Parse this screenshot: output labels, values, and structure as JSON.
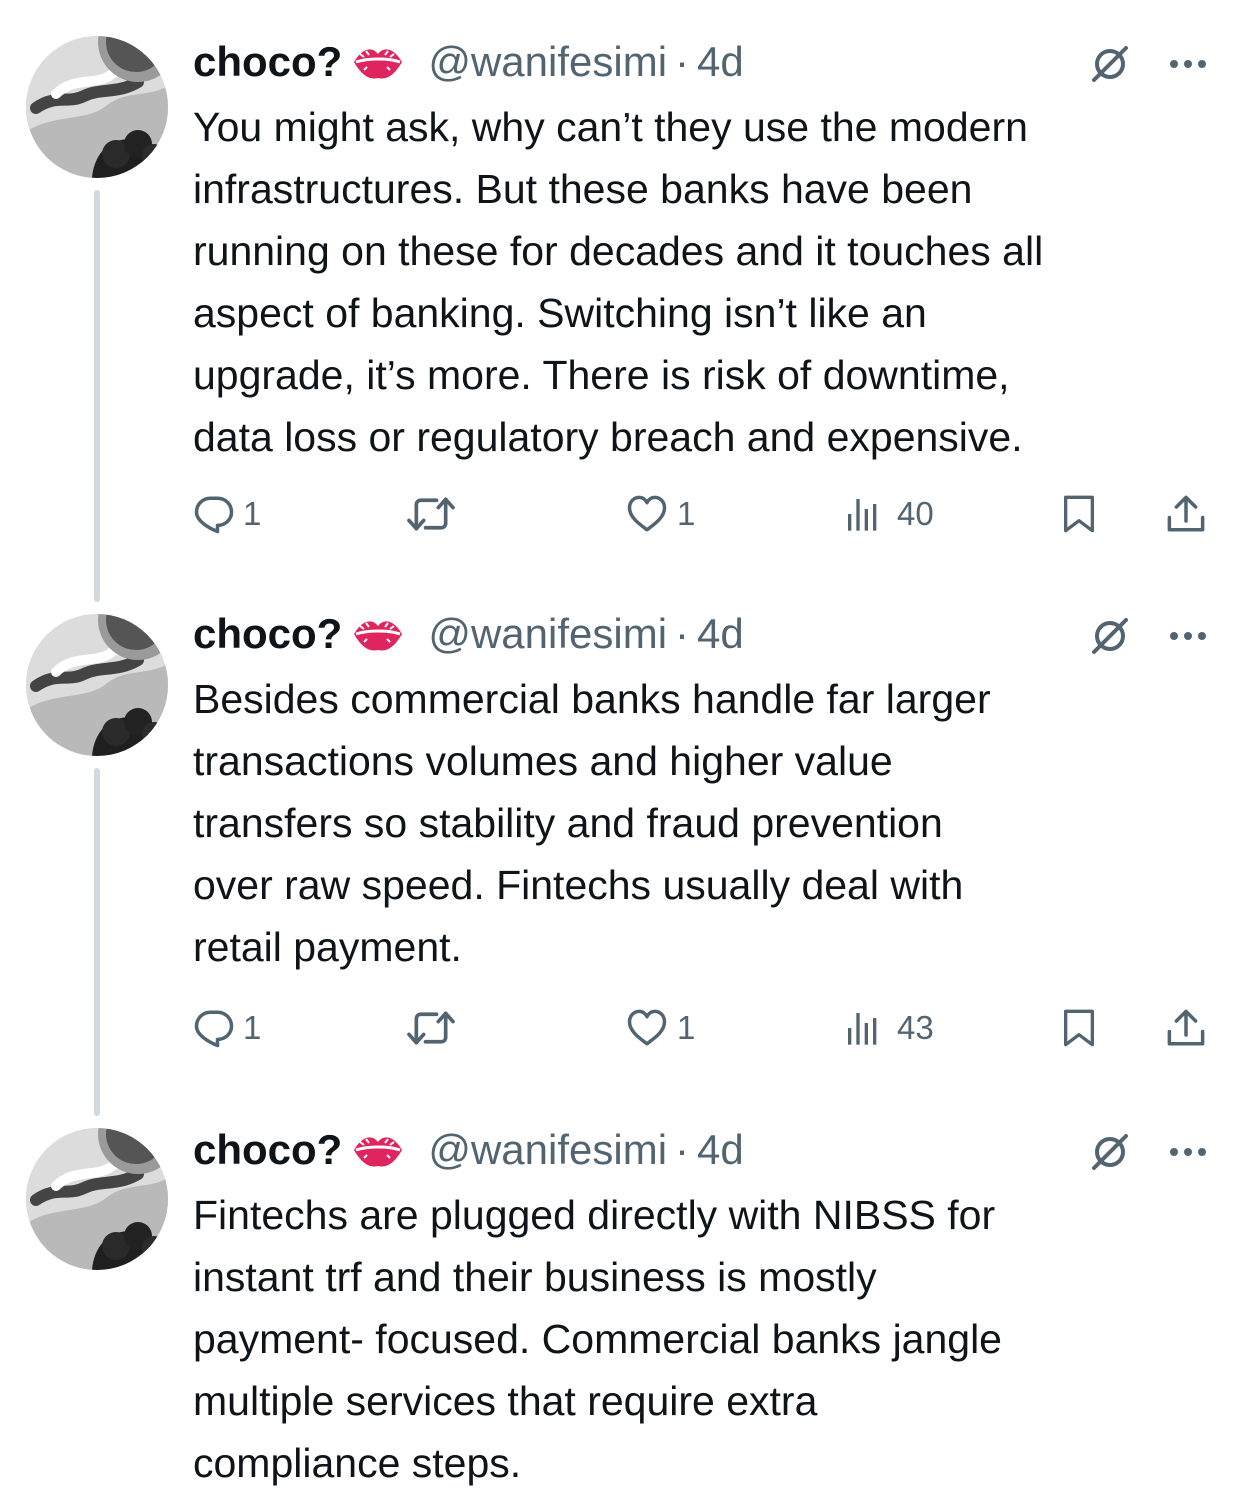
{
  "tweets": [
    {
      "author_name": "choco?",
      "handle": "@wanifesimi",
      "dot": "·",
      "time": "4d",
      "text": "You might ask, why can’t they use the modern\ninfrastructures. But these banks have been\nrunning on these for decades and it touches all\naspect of banking. Switching isn’t like an\nupgrade, it’s more. There is risk of downtime,\ndata loss or regulatory breach and expensive.",
      "replies": "1",
      "likes": "1",
      "views": "40"
    },
    {
      "author_name": "choco?",
      "handle": "@wanifesimi",
      "dot": "·",
      "time": "4d",
      "text": "Besides commercial banks handle far larger\ntransactions volumes and higher value\ntransfers so stability and fraud prevention\nover raw speed. Fintechs usually deal with\nretail payment.",
      "replies": "1",
      "likes": "1",
      "views": "43"
    },
    {
      "author_name": "choco?",
      "handle": "@wanifesimi",
      "dot": "·",
      "time": "4d",
      "text": "Fintechs are plugged directly with NIBSS for\ninstant trf and their business is mostly\npayment- focused. Commercial banks jangle\nmultiple services that require extra\ncompliance steps."
    }
  ],
  "icons": {
    "name_emoji": "kiss-mark-icon",
    "grok": "grok-icon",
    "more": "more-icon",
    "reply": "reply-icon",
    "repost": "repost-icon",
    "like": "like-icon",
    "views": "views-icon",
    "bookmark": "bookmark-icon",
    "share": "share-icon"
  },
  "colors": {
    "text": "#0f1419",
    "secondary": "#536471",
    "thread_line": "#cfd9de",
    "lips": "#e0245e"
  }
}
